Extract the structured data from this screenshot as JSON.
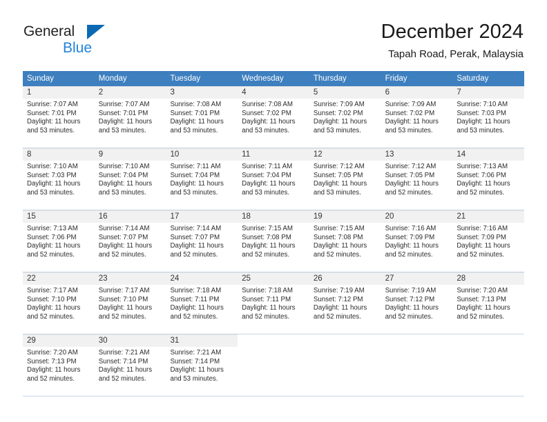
{
  "brand": {
    "line1": "General",
    "line2": "Blue",
    "triangle_color": "#0b69b4",
    "line2_color": "#1f83d9"
  },
  "header": {
    "title": "December 2024",
    "subtitle": "Tapah Road, Perak, Malaysia"
  },
  "theme": {
    "header_row_bg": "#3d7fbf",
    "day_band_bg": "#f1f1f1",
    "grid_line": "#c8d8e8"
  },
  "weekdays": [
    "Sunday",
    "Monday",
    "Tuesday",
    "Wednesday",
    "Thursday",
    "Friday",
    "Saturday"
  ],
  "weeks": [
    [
      {
        "day": "1",
        "sunrise": "Sunrise: 7:07 AM",
        "sunset": "Sunset: 7:01 PM",
        "daylight1": "Daylight: 11 hours",
        "daylight2": "and 53 minutes."
      },
      {
        "day": "2",
        "sunrise": "Sunrise: 7:07 AM",
        "sunset": "Sunset: 7:01 PM",
        "daylight1": "Daylight: 11 hours",
        "daylight2": "and 53 minutes."
      },
      {
        "day": "3",
        "sunrise": "Sunrise: 7:08 AM",
        "sunset": "Sunset: 7:01 PM",
        "daylight1": "Daylight: 11 hours",
        "daylight2": "and 53 minutes."
      },
      {
        "day": "4",
        "sunrise": "Sunrise: 7:08 AM",
        "sunset": "Sunset: 7:02 PM",
        "daylight1": "Daylight: 11 hours",
        "daylight2": "and 53 minutes."
      },
      {
        "day": "5",
        "sunrise": "Sunrise: 7:09 AM",
        "sunset": "Sunset: 7:02 PM",
        "daylight1": "Daylight: 11 hours",
        "daylight2": "and 53 minutes."
      },
      {
        "day": "6",
        "sunrise": "Sunrise: 7:09 AM",
        "sunset": "Sunset: 7:02 PM",
        "daylight1": "Daylight: 11 hours",
        "daylight2": "and 53 minutes."
      },
      {
        "day": "7",
        "sunrise": "Sunrise: 7:10 AM",
        "sunset": "Sunset: 7:03 PM",
        "daylight1": "Daylight: 11 hours",
        "daylight2": "and 53 minutes."
      }
    ],
    [
      {
        "day": "8",
        "sunrise": "Sunrise: 7:10 AM",
        "sunset": "Sunset: 7:03 PM",
        "daylight1": "Daylight: 11 hours",
        "daylight2": "and 53 minutes."
      },
      {
        "day": "9",
        "sunrise": "Sunrise: 7:10 AM",
        "sunset": "Sunset: 7:04 PM",
        "daylight1": "Daylight: 11 hours",
        "daylight2": "and 53 minutes."
      },
      {
        "day": "10",
        "sunrise": "Sunrise: 7:11 AM",
        "sunset": "Sunset: 7:04 PM",
        "daylight1": "Daylight: 11 hours",
        "daylight2": "and 53 minutes."
      },
      {
        "day": "11",
        "sunrise": "Sunrise: 7:11 AM",
        "sunset": "Sunset: 7:04 PM",
        "daylight1": "Daylight: 11 hours",
        "daylight2": "and 53 minutes."
      },
      {
        "day": "12",
        "sunrise": "Sunrise: 7:12 AM",
        "sunset": "Sunset: 7:05 PM",
        "daylight1": "Daylight: 11 hours",
        "daylight2": "and 53 minutes."
      },
      {
        "day": "13",
        "sunrise": "Sunrise: 7:12 AM",
        "sunset": "Sunset: 7:05 PM",
        "daylight1": "Daylight: 11 hours",
        "daylight2": "and 52 minutes."
      },
      {
        "day": "14",
        "sunrise": "Sunrise: 7:13 AM",
        "sunset": "Sunset: 7:06 PM",
        "daylight1": "Daylight: 11 hours",
        "daylight2": "and 52 minutes."
      }
    ],
    [
      {
        "day": "15",
        "sunrise": "Sunrise: 7:13 AM",
        "sunset": "Sunset: 7:06 PM",
        "daylight1": "Daylight: 11 hours",
        "daylight2": "and 52 minutes."
      },
      {
        "day": "16",
        "sunrise": "Sunrise: 7:14 AM",
        "sunset": "Sunset: 7:07 PM",
        "daylight1": "Daylight: 11 hours",
        "daylight2": "and 52 minutes."
      },
      {
        "day": "17",
        "sunrise": "Sunrise: 7:14 AM",
        "sunset": "Sunset: 7:07 PM",
        "daylight1": "Daylight: 11 hours",
        "daylight2": "and 52 minutes."
      },
      {
        "day": "18",
        "sunrise": "Sunrise: 7:15 AM",
        "sunset": "Sunset: 7:08 PM",
        "daylight1": "Daylight: 11 hours",
        "daylight2": "and 52 minutes."
      },
      {
        "day": "19",
        "sunrise": "Sunrise: 7:15 AM",
        "sunset": "Sunset: 7:08 PM",
        "daylight1": "Daylight: 11 hours",
        "daylight2": "and 52 minutes."
      },
      {
        "day": "20",
        "sunrise": "Sunrise: 7:16 AM",
        "sunset": "Sunset: 7:09 PM",
        "daylight1": "Daylight: 11 hours",
        "daylight2": "and 52 minutes."
      },
      {
        "day": "21",
        "sunrise": "Sunrise: 7:16 AM",
        "sunset": "Sunset: 7:09 PM",
        "daylight1": "Daylight: 11 hours",
        "daylight2": "and 52 minutes."
      }
    ],
    [
      {
        "day": "22",
        "sunrise": "Sunrise: 7:17 AM",
        "sunset": "Sunset: 7:10 PM",
        "daylight1": "Daylight: 11 hours",
        "daylight2": "and 52 minutes."
      },
      {
        "day": "23",
        "sunrise": "Sunrise: 7:17 AM",
        "sunset": "Sunset: 7:10 PM",
        "daylight1": "Daylight: 11 hours",
        "daylight2": "and 52 minutes."
      },
      {
        "day": "24",
        "sunrise": "Sunrise: 7:18 AM",
        "sunset": "Sunset: 7:11 PM",
        "daylight1": "Daylight: 11 hours",
        "daylight2": "and 52 minutes."
      },
      {
        "day": "25",
        "sunrise": "Sunrise: 7:18 AM",
        "sunset": "Sunset: 7:11 PM",
        "daylight1": "Daylight: 11 hours",
        "daylight2": "and 52 minutes."
      },
      {
        "day": "26",
        "sunrise": "Sunrise: 7:19 AM",
        "sunset": "Sunset: 7:12 PM",
        "daylight1": "Daylight: 11 hours",
        "daylight2": "and 52 minutes."
      },
      {
        "day": "27",
        "sunrise": "Sunrise: 7:19 AM",
        "sunset": "Sunset: 7:12 PM",
        "daylight1": "Daylight: 11 hours",
        "daylight2": "and 52 minutes."
      },
      {
        "day": "28",
        "sunrise": "Sunrise: 7:20 AM",
        "sunset": "Sunset: 7:13 PM",
        "daylight1": "Daylight: 11 hours",
        "daylight2": "and 52 minutes."
      }
    ],
    [
      {
        "day": "29",
        "sunrise": "Sunrise: 7:20 AM",
        "sunset": "Sunset: 7:13 PM",
        "daylight1": "Daylight: 11 hours",
        "daylight2": "and 52 minutes."
      },
      {
        "day": "30",
        "sunrise": "Sunrise: 7:21 AM",
        "sunset": "Sunset: 7:14 PM",
        "daylight1": "Daylight: 11 hours",
        "daylight2": "and 52 minutes."
      },
      {
        "day": "31",
        "sunrise": "Sunrise: 7:21 AM",
        "sunset": "Sunset: 7:14 PM",
        "daylight1": "Daylight: 11 hours",
        "daylight2": "and 53 minutes."
      },
      {
        "day": "",
        "sunrise": "",
        "sunset": "",
        "daylight1": "",
        "daylight2": ""
      },
      {
        "day": "",
        "sunrise": "",
        "sunset": "",
        "daylight1": "",
        "daylight2": ""
      },
      {
        "day": "",
        "sunrise": "",
        "sunset": "",
        "daylight1": "",
        "daylight2": ""
      },
      {
        "day": "",
        "sunrise": "",
        "sunset": "",
        "daylight1": "",
        "daylight2": ""
      }
    ]
  ]
}
